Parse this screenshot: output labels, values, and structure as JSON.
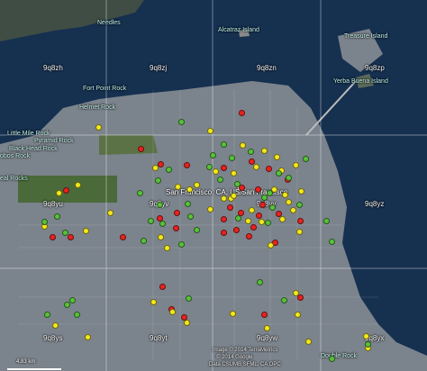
{
  "colors": {
    "red": "#e8231f",
    "yellow": "#f4e81c",
    "green": "#58c23a",
    "water": "#16304e",
    "land": "#7d858d",
    "grid": "#ffffff"
  },
  "labels": {
    "geo": {
      "needles": "Needles",
      "alcatraz": "Alcatraz Island",
      "treasure": "Treasure Island",
      "yerba": "Yerba Buena Island",
      "fortpoint": "Fort Point Rock",
      "helmet": "Helmet Rock",
      "littlemile": "Little Mile Rock",
      "pyramid": "Pyramid Rock",
      "blackhead": "Black Head Rock",
      "lobos": "obos Rock",
      "seal": "eal Rocks",
      "double": "Double Rock"
    },
    "hash": {
      "zh": "9q8zh",
      "zj": "9q8zj",
      "zn": "9q8zn",
      "zp": "9q8zp",
      "yu": "9q8yu",
      "yv": "9q8yv",
      "yy": "9q8yy",
      "yz": "9q8yz",
      "ys": "9q8ys",
      "yt": "9q8yt",
      "yw": "9q8yw",
      "yx": "9q8yx"
    },
    "city_a": "San Francisco, CA, USA",
    "city_b": "San Francisco",
    "credit_1": "Image © 2014 TerraMetrics",
    "credit_2": "© 2014 Google",
    "credit_3": "Data CSUMB SFML, CA OPC",
    "scale": "4.83 km"
  },
  "markers": {
    "red": 34,
    "yellow": 48,
    "green": 42
  }
}
